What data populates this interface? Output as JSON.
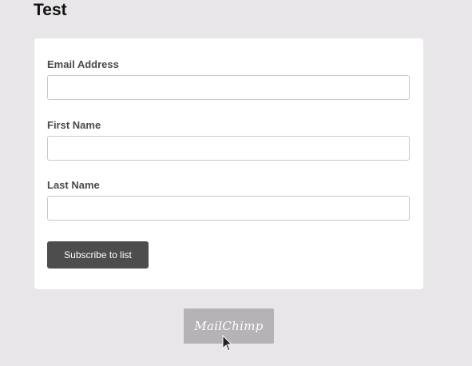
{
  "page": {
    "title": "Test"
  },
  "form": {
    "fields": [
      {
        "label": "Email Address",
        "value": "",
        "placeholder": ""
      },
      {
        "label": "First Name",
        "value": "",
        "placeholder": ""
      },
      {
        "label": "Last Name",
        "value": "",
        "placeholder": ""
      }
    ],
    "submit_label": "Subscribe to list"
  },
  "badge": {
    "text": "MailChimp"
  },
  "colors": {
    "page_background": "#e8e6e8",
    "card_background": "#ffffff",
    "button_background": "#4d4d4e",
    "badge_background": "#b5b3b5"
  },
  "icons": {
    "cursor": "mouse-pointer-icon"
  }
}
